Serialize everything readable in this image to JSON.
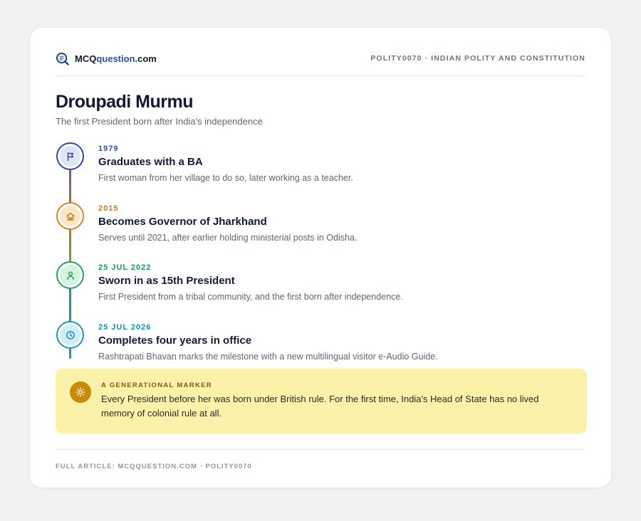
{
  "brand": {
    "name_prefix": "MCQ",
    "name_highlight": "question",
    "name_suffix": ".com",
    "icon": "mcq-logo-icon"
  },
  "header": {
    "tag": "POLITY0070 · INDIAN POLITY AND CONSTITUTION"
  },
  "title": "Droupadi Murmu",
  "subtitle": "The first President born after India's independence",
  "timeline": [
    {
      "date": "1979",
      "title": "Graduates with a BA",
      "desc": "First woman from her village to do so, later working as a teacher.",
      "icon": "flag-icon",
      "color": "#2f48a3"
    },
    {
      "date": "2015",
      "title": "Becomes Governor of Jharkhand",
      "desc": "Serves until 2021, after earlier holding ministerial posts in Odisha.",
      "icon": "house-icon",
      "color": "#d3841d"
    },
    {
      "date": "25 JUL 2022",
      "title": "Sworn in as 15th President",
      "desc": "First President from a tribal community, and the first born after independence.",
      "icon": "person-icon",
      "color": "#26a35a"
    },
    {
      "date": "25 JUL 2026",
      "title": "Completes four years in office",
      "desc": "Rashtrapati Bhavan marks the milestone with a new multilingual visitor e-Audio Guide.",
      "icon": "clock-icon",
      "color": "#1c98b8"
    }
  ],
  "callout": {
    "label": "A GENERATIONAL MARKER",
    "text": "Every President before her was born under British rule. For the first time, India's Head of State has no lived memory of colonial rule at all.",
    "icon": "sun-icon",
    "color": "#fbf1a9"
  },
  "footer": "FULL ARTICLE: MCQQUESTION.COM · POLITY0070"
}
